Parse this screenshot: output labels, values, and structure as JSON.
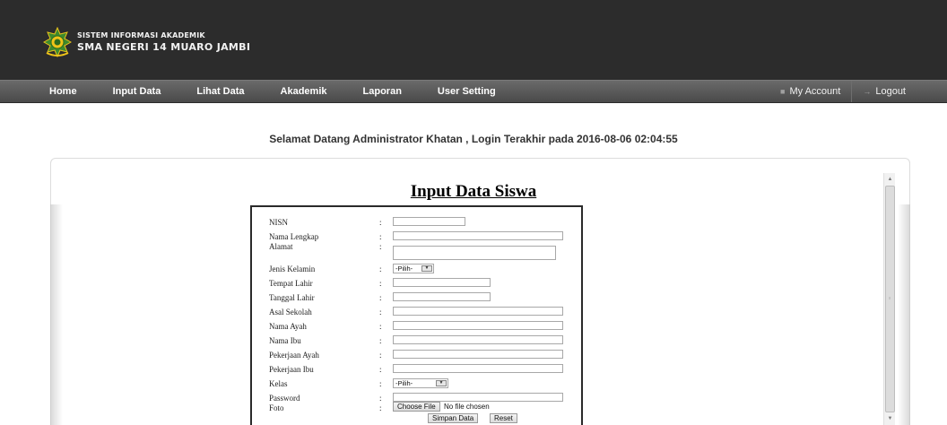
{
  "header": {
    "logo_line1": "SISTEM INFORMASI AKADEMIK",
    "logo_line2": "SMA NEGERI 14 MUARO JAMBI",
    "emblem_icon": "school-emblem-icon",
    "background": "#2c2c2c"
  },
  "nav": {
    "items": [
      {
        "label": "Home"
      },
      {
        "label": "Input Data"
      },
      {
        "label": "Lihat Data"
      },
      {
        "label": "Akademik"
      },
      {
        "label": "Laporan"
      },
      {
        "label": "User Setting"
      }
    ],
    "my_account": "My Account",
    "my_account_icon": "user-icon",
    "logout": "Logout",
    "logout_icon": "arrow-right-icon"
  },
  "greeting": "Selamat Datang Administrator Khatan , Login Terakhir pada 2016-08-06 02:04:55",
  "form": {
    "title": "Input Data Siswa",
    "colon": ":",
    "fields": {
      "nisn": "NISN",
      "nama_lengkap": "Nama Lengkap",
      "alamat": "Alamat",
      "jenis_kelamin": "Jenis Kelamin",
      "tempat_lahir": "Tempat Lahir",
      "tanggal_lahir": "Tanggal Lahir",
      "asal_sekolah": "Asal Sekolah",
      "nama_ayah": "Nama Ayah",
      "nama_ibu": "Nama Ibu",
      "pekerjaan_ayah": "Pekerjaan Ayah",
      "pekerjaan_ibu": "Pekerjaan Ibu",
      "kelas": "Kelas",
      "password": "Password",
      "foto": "Foto"
    },
    "jenis_kelamin_selected": "-Pilih-",
    "kelas_selected": "-Pilih-",
    "choose_file": "Choose File",
    "no_file": "No file chosen",
    "submit": "Simpan Data",
    "reset": "Reset"
  }
}
